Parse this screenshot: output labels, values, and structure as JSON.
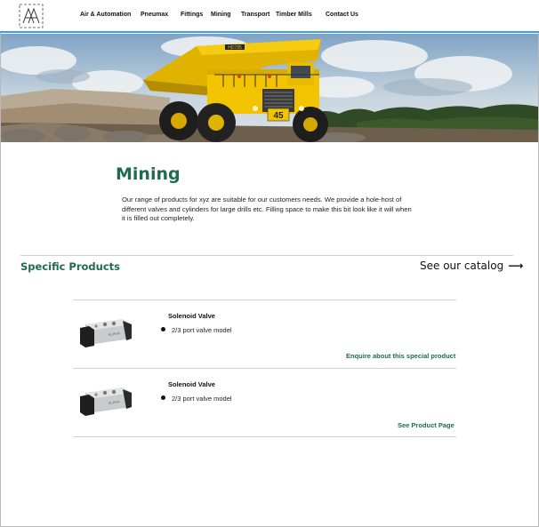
{
  "nav": {
    "items": [
      "Air & Automation",
      "Pneumax",
      "Fittings",
      "Mining",
      "Transport",
      "Timber Mills",
      "Contact Us"
    ]
  },
  "page": {
    "title": "Mining",
    "intro": "Our range of products for xyz are suitable for our customers needs. We provide a hole-host of different valves and cylinders for large drills etc. Filling space to make this bit look like it will when it is filled out completely."
  },
  "products_section": {
    "heading": "Specific Products",
    "catalog_link": "See our catalog",
    "catalog_arrow": "⟶"
  },
  "products": [
    {
      "name": "Solenoid Valve",
      "feature": "2/3 port valve model",
      "link": "Enquire about this special product"
    },
    {
      "name": "Solenoid Valve",
      "feature": "2/3 port valve model",
      "link": "See Product Page"
    }
  ],
  "hero": {
    "truck_badge": "HD785",
    "truck_number": "45"
  },
  "valve_label": "ALPHA",
  "colors": {
    "brand_green": "#1f6b4e",
    "nav_accent": "#3aa0e6",
    "truck_yellow": "#f2c400"
  }
}
